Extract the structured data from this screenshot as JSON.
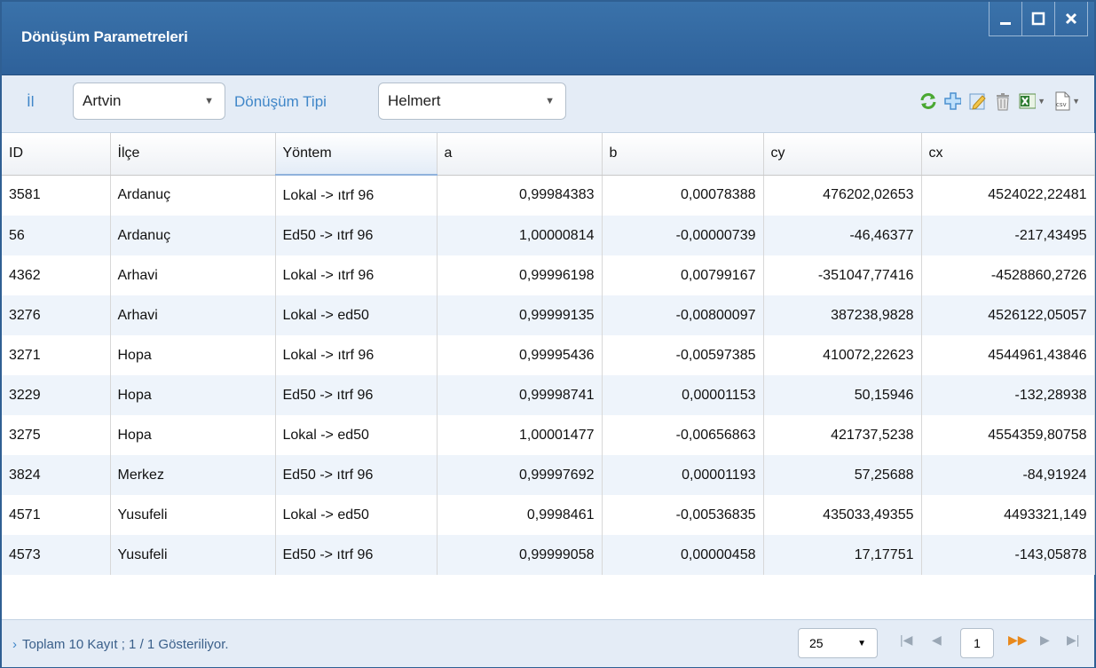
{
  "window": {
    "title": "Dönüşüm Parametreleri"
  },
  "toolbar": {
    "province_label": "İl",
    "province_value": "Artvin",
    "type_label": "Dönüşüm Tipi",
    "type_value": "Helmert",
    "icons": [
      "refresh-icon",
      "add-icon",
      "edit-icon",
      "delete-icon",
      "excel-export-icon",
      "csv-export-icon"
    ]
  },
  "table": {
    "columns": [
      "ID",
      "İlçe",
      "Yöntem",
      "a",
      "b",
      "cy",
      "cx"
    ],
    "rows": [
      [
        "3581",
        "Ardanuç",
        "Lokal -> ıtrf 96",
        "0,99984383",
        "0,00078388",
        "476202,02653",
        "4524022,22481"
      ],
      [
        "56",
        "Ardanuç",
        "Ed50 -> ıtrf 96",
        "1,00000814",
        "-0,00000739",
        "-46,46377",
        "-217,43495"
      ],
      [
        "4362",
        "Arhavi",
        "Lokal -> ıtrf 96",
        "0,99996198",
        "0,00799167",
        "-351047,77416",
        "-4528860,2726"
      ],
      [
        "3276",
        "Arhavi",
        "Lokal -> ed50",
        "0,99999135",
        "-0,00800097",
        "387238,9828",
        "4526122,05057"
      ],
      [
        "3271",
        "Hopa",
        "Lokal -> ıtrf 96",
        "0,99995436",
        "-0,00597385",
        "410072,22623",
        "4544961,43846"
      ],
      [
        "3229",
        "Hopa",
        "Ed50 -> ıtrf 96",
        "0,99998741",
        "0,00001153",
        "50,15946",
        "-132,28938"
      ],
      [
        "3275",
        "Hopa",
        "Lokal -> ed50",
        "1,00001477",
        "-0,00656863",
        "421737,5238",
        "4554359,80758"
      ],
      [
        "3824",
        "Merkez",
        "Ed50 -> ıtrf 96",
        "0,99997692",
        "0,00001193",
        "57,25688",
        "-84,91924"
      ],
      [
        "4571",
        "Yusufeli",
        "Lokal -> ed50",
        "0,9998461",
        "-0,00536835",
        "435033,49355",
        "4493321,149"
      ],
      [
        "4573",
        "Yusufeli",
        "Ed50 -> ıtrf 96",
        "0,99999058",
        "0,00000458",
        "17,17751",
        "-143,05878"
      ]
    ]
  },
  "footer": {
    "status": "Toplam 10 Kayıt ; 1 / 1 Gösteriliyor.",
    "page_size": "25",
    "page": "1"
  },
  "colors": {
    "titlebar": "#2e619a",
    "toolbar": "#e4ecf6",
    "label": "#3f86c8",
    "row_alt": "#eef4fb"
  }
}
